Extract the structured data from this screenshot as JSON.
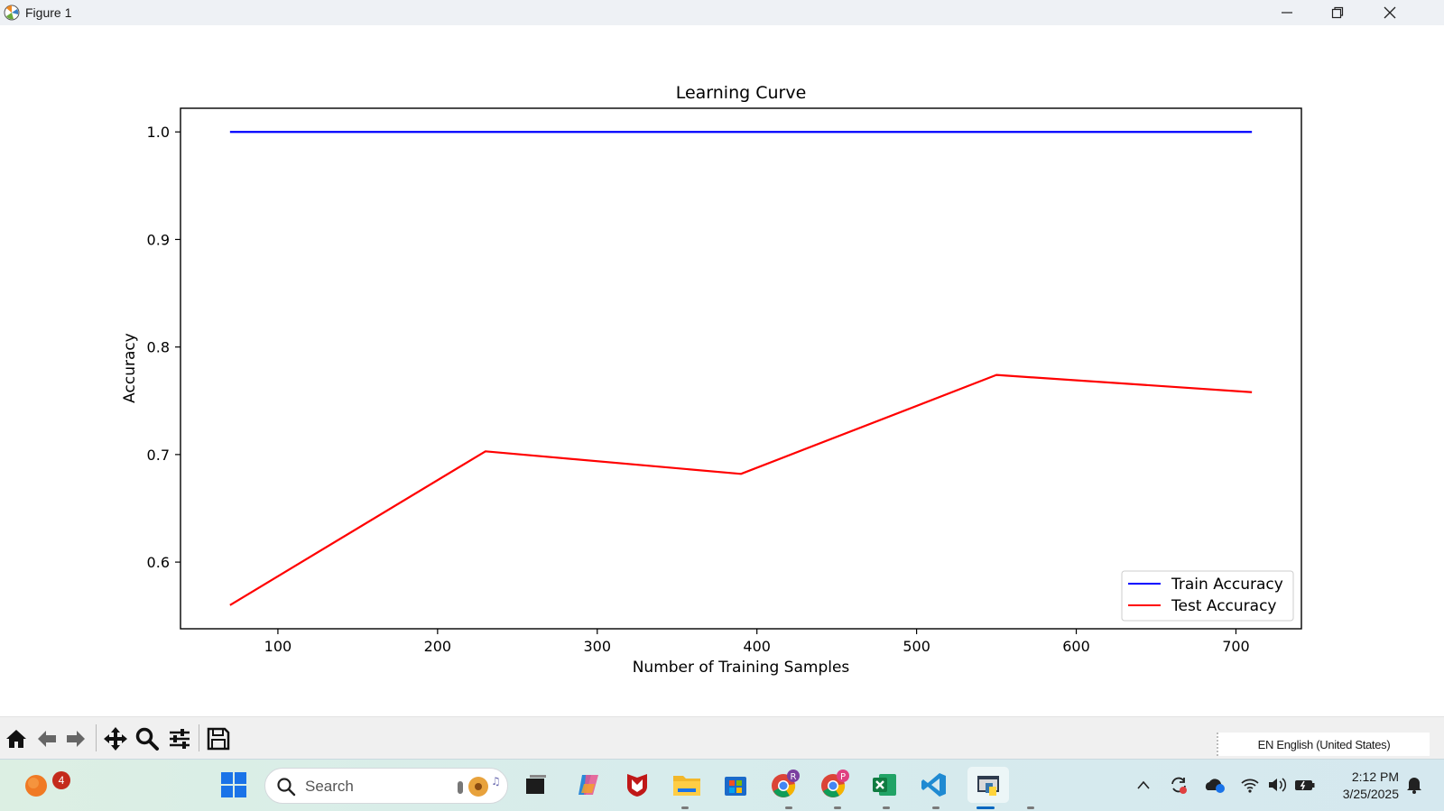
{
  "window": {
    "title": "Figure 1"
  },
  "chart_data": {
    "type": "line",
    "title": "Learning Curve",
    "xlabel": "Number of Training Samples",
    "ylabel": "Accuracy",
    "xlim": [
      39,
      741
    ],
    "ylim": [
      0.538,
      1.022
    ],
    "xticks": [
      100,
      200,
      300,
      400,
      500,
      600,
      700
    ],
    "yticks": [
      0.6,
      0.7,
      0.8,
      0.9,
      1.0
    ],
    "ytick_labels": [
      "0.6",
      "0.7",
      "0.8",
      "0.9",
      "1.0"
    ],
    "x": [
      70,
      230,
      390,
      550,
      710
    ],
    "series": [
      {
        "name": "Train Accuracy",
        "color": "#0000ff",
        "values": [
          1.0,
          1.0,
          1.0,
          1.0,
          1.0
        ]
      },
      {
        "name": "Test Accuracy",
        "color": "#ff0000",
        "values": [
          0.56,
          0.703,
          0.682,
          0.774,
          0.758
        ]
      }
    ],
    "legend_position": "lower-right",
    "grid": false
  },
  "toolbar": {
    "buttons": [
      "home-icon",
      "back-icon",
      "forward-icon",
      "pan-icon",
      "zoom-icon",
      "configure-subplots-icon",
      "save-icon"
    ]
  },
  "language_bar": {
    "label": "EN English (United States)"
  },
  "taskbar": {
    "search_placeholder": "Search",
    "notification_badge": "4",
    "profile_badges": [
      "R",
      "P"
    ],
    "time": "2:12 PM",
    "date": "3/25/2025"
  }
}
